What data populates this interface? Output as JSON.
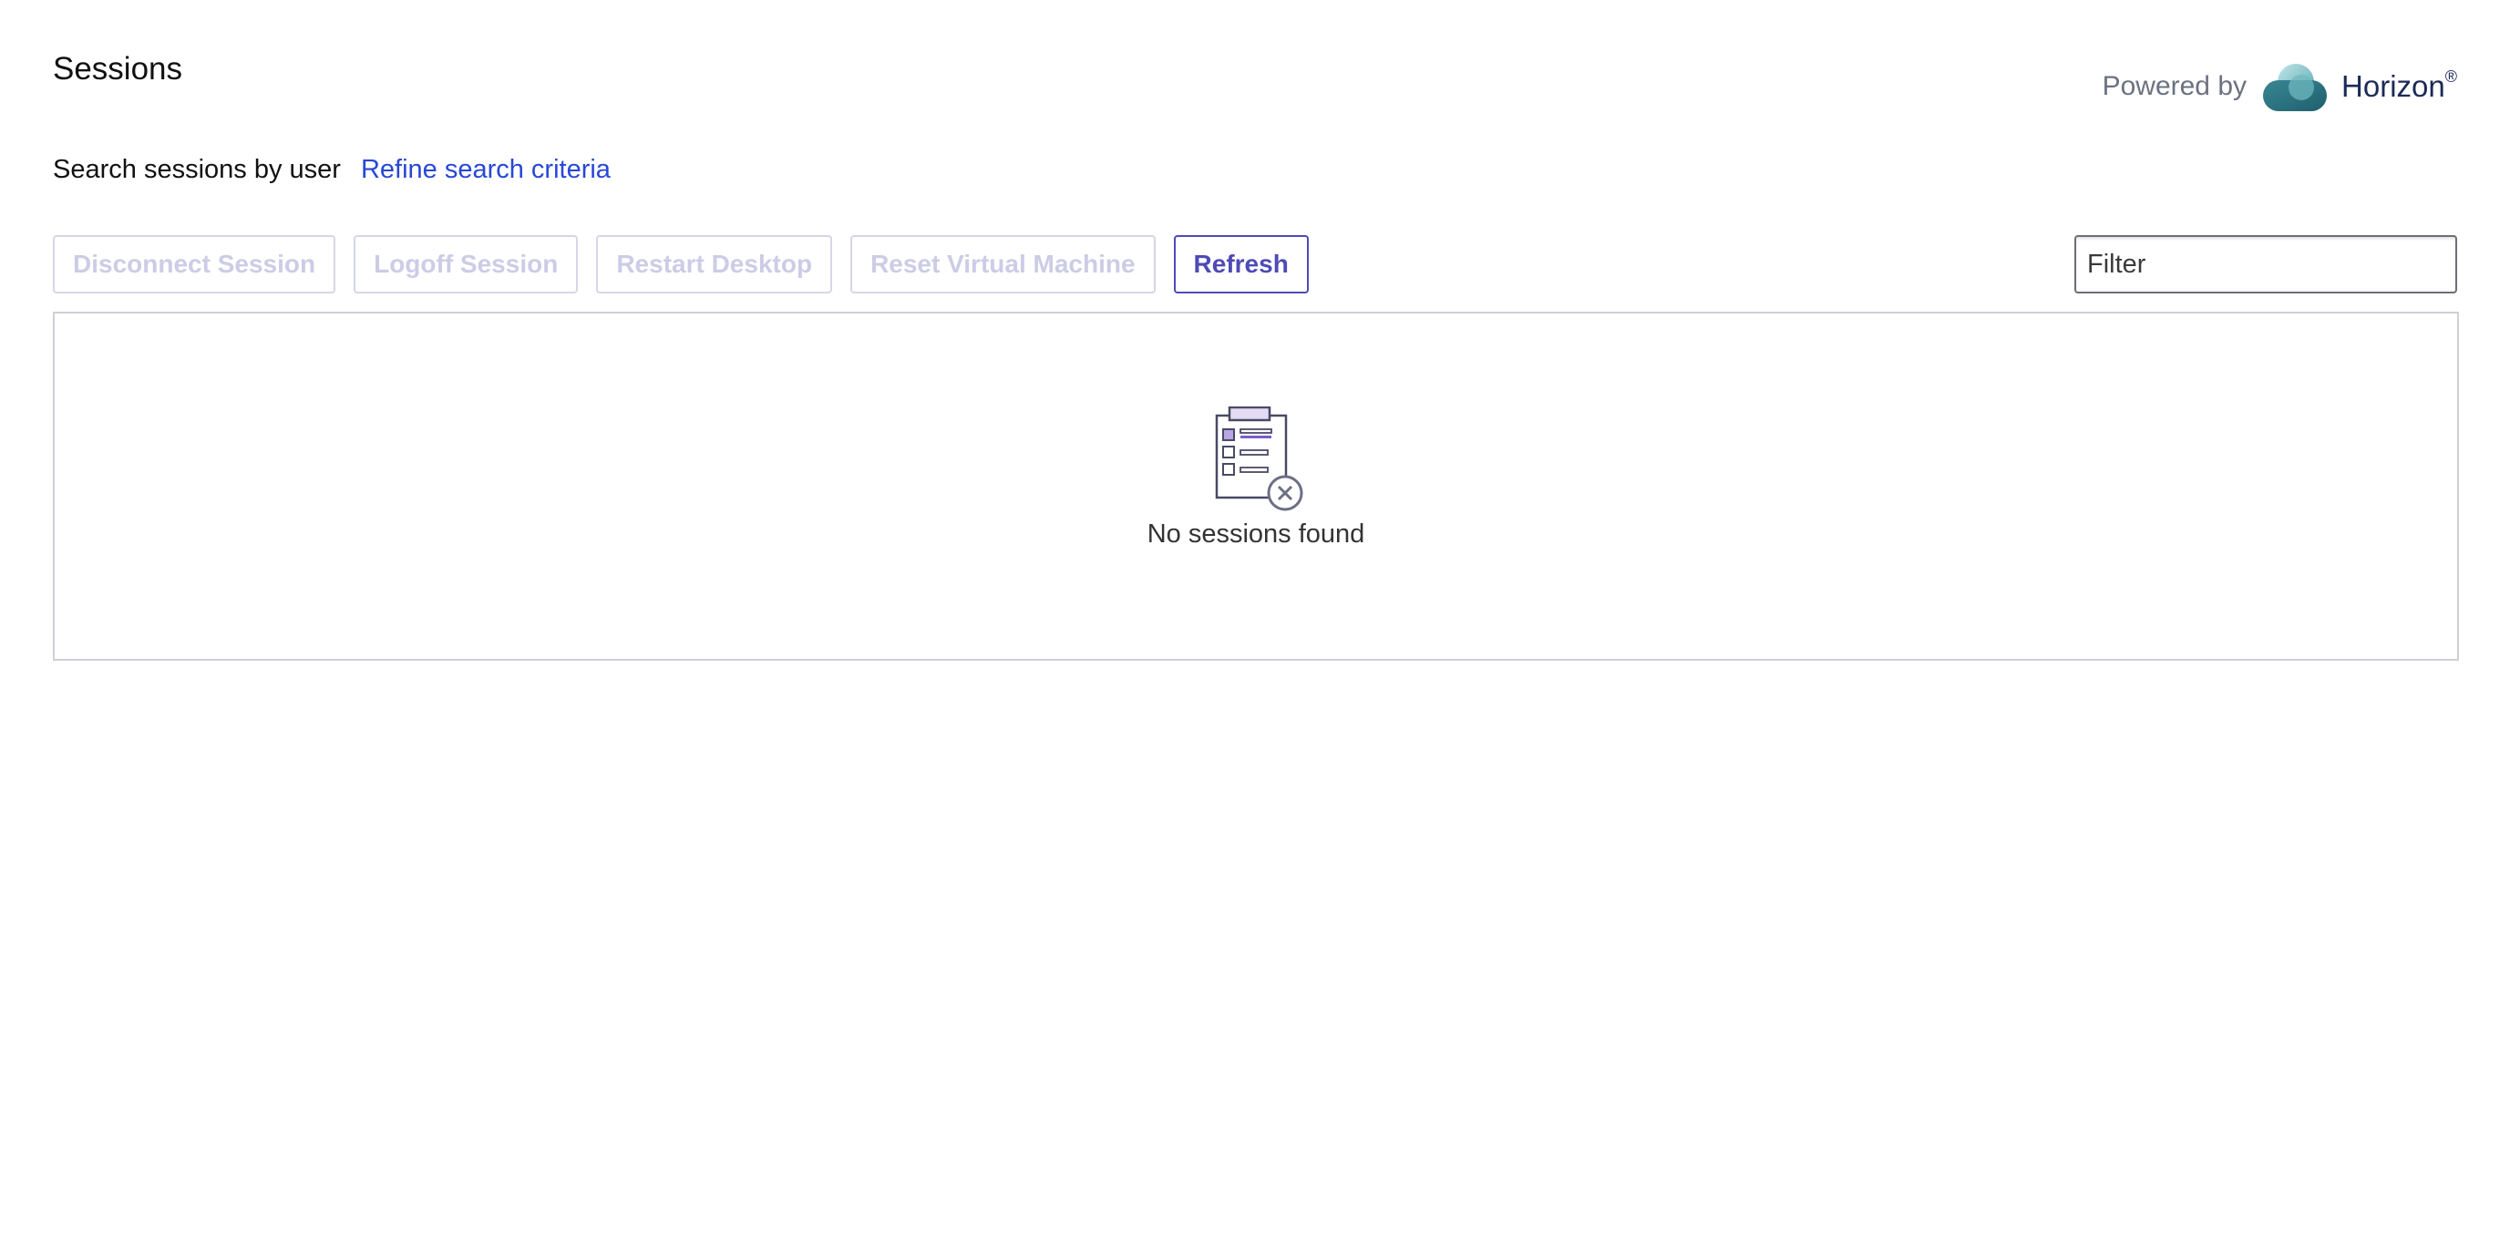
{
  "header": {
    "title": "Sessions",
    "powered_by": "Powered by",
    "brand_name": "Horizon",
    "brand_mark": "®"
  },
  "search": {
    "label": "Search sessions by user",
    "refine_link": "Refine search criteria"
  },
  "toolbar": {
    "buttons": [
      {
        "label": "Disconnect Session",
        "enabled": false
      },
      {
        "label": "Logoff Session",
        "enabled": false
      },
      {
        "label": "Restart Desktop",
        "enabled": false
      },
      {
        "label": "Reset Virtual Machine",
        "enabled": false
      },
      {
        "label": "Refresh",
        "enabled": true
      }
    ],
    "filter_placeholder": "Filter"
  },
  "grid": {
    "empty_message": "No sessions found",
    "empty_icon": "clipboard-empty-icon"
  },
  "colors": {
    "accent": "#4e4ab8",
    "link": "#2747d6",
    "disabled": "#cccce6",
    "brand_text": "#1c2a57"
  }
}
